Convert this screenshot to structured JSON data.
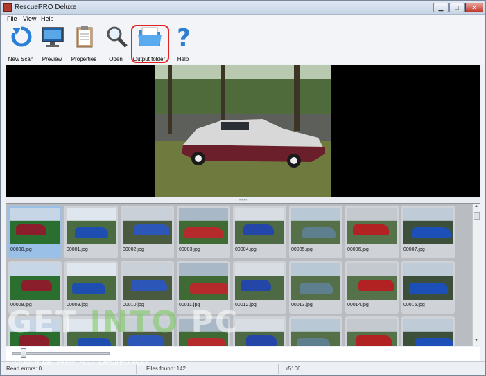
{
  "window": {
    "title": "RescuePRO Deluxe"
  },
  "menu": [
    "File",
    "View",
    "Help"
  ],
  "toolbar": [
    {
      "label": "New Scan",
      "icon": "refresh-icon"
    },
    {
      "label": "Preview",
      "icon": "monitor-icon"
    },
    {
      "label": "Properties",
      "icon": "clipboard-icon"
    },
    {
      "label": "Open",
      "icon": "magnifier-icon"
    },
    {
      "label": "Output folder",
      "icon": "folder-icon"
    },
    {
      "label": "Help",
      "icon": "question-icon"
    }
  ],
  "gallery": {
    "selected": "00000.jpg",
    "files": [
      "00000.jpg",
      "00001.jpg",
      "00002.jpg",
      "00003.jpg",
      "00004.jpg",
      "00005.jpg",
      "00006.jpg",
      "00007.jpg",
      "00008.jpg",
      "00009.jpg",
      "00010.jpg",
      "00011.jpg",
      "00012.jpg",
      "00013.jpg",
      "00014.jpg",
      "00015.jpg",
      "",
      "",
      "",
      "",
      "",
      "",
      "",
      ""
    ]
  },
  "status": {
    "read_errors": "Read errors: 0",
    "files_found": "Files found: 142",
    "version": "r5106"
  },
  "watermark": {
    "logo_get": "GET",
    "logo_into": "INTO",
    "logo_pc": "PC",
    "tagline": "Download Free Your Desired App"
  },
  "colors": {
    "highlight": "#e22222",
    "selection": "#9bc0e8"
  }
}
